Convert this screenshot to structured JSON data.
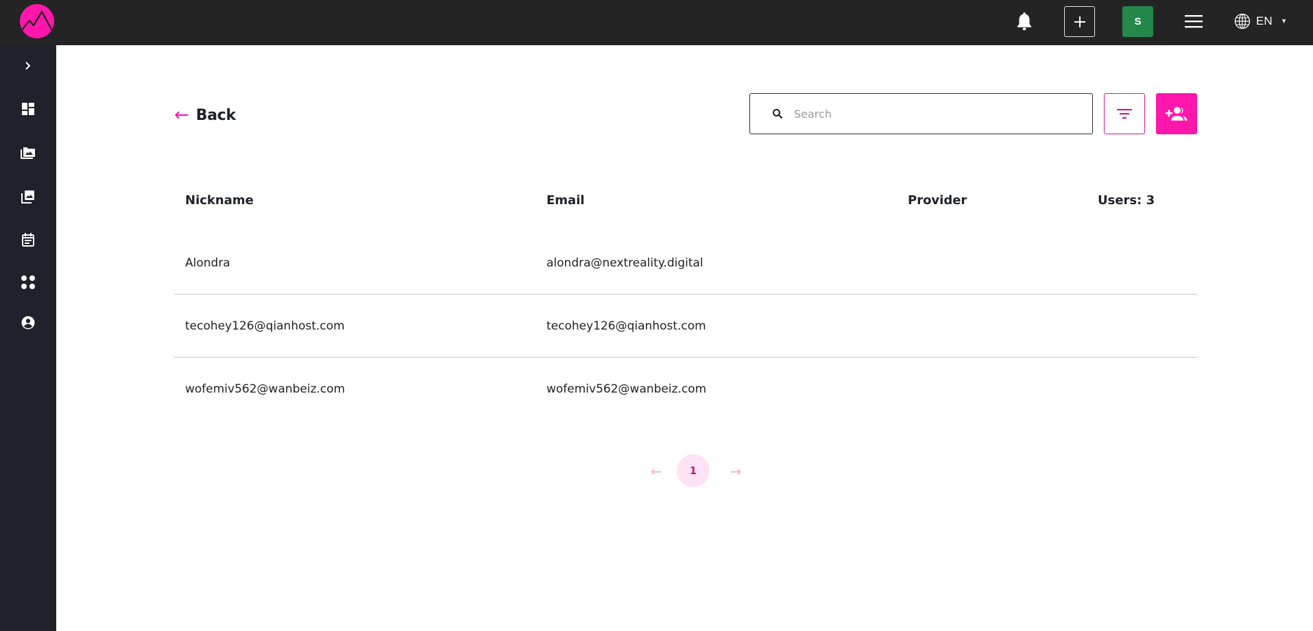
{
  "header": {
    "logo_icon": "mountain-peak-logo",
    "notifications_icon": "bell-icon",
    "create_icon": "plus-icon",
    "avatar_initial": "S",
    "menu_icon": "hamburger-icon",
    "language": "EN",
    "language_icon": "globe-icon",
    "colors": {
      "background": "#242424",
      "brand": "#ff16ab",
      "avatar": "#23884a"
    }
  },
  "sidebar": {
    "items": [
      {
        "icon": "chevron-right-icon",
        "label": "Expand"
      },
      {
        "icon": "dashboard-icon",
        "label": "Dashboard"
      },
      {
        "icon": "photo-library-folder-icon",
        "label": "Albums"
      },
      {
        "icon": "photo-library-icon",
        "label": "Media"
      },
      {
        "icon": "calendar-icon",
        "label": "Events"
      },
      {
        "icon": "apps-dots-icon",
        "label": "Apps"
      },
      {
        "icon": "account-circle-icon",
        "label": "Users"
      }
    ]
  },
  "toolbar": {
    "back_label": "Back",
    "search_placeholder": "Search",
    "search_value": "",
    "filter_icon": "filter-icon",
    "add_user_icon": "group-add-icon"
  },
  "table": {
    "columns": [
      "Nickname",
      "Email",
      "Provider"
    ],
    "count_label": "Users: 3",
    "rows": [
      {
        "nickname": "Alondra",
        "email": "alondra@nextreality.digital",
        "provider": ""
      },
      {
        "nickname": "tecohey126@qianhost.com",
        "email": "tecohey126@qianhost.com",
        "provider": ""
      },
      {
        "nickname": "wofemiv562@wanbeiz.com",
        "email": "wofemiv562@wanbeiz.com",
        "provider": ""
      }
    ]
  },
  "pagination": {
    "prev": "←",
    "current": "1",
    "next": "→"
  }
}
